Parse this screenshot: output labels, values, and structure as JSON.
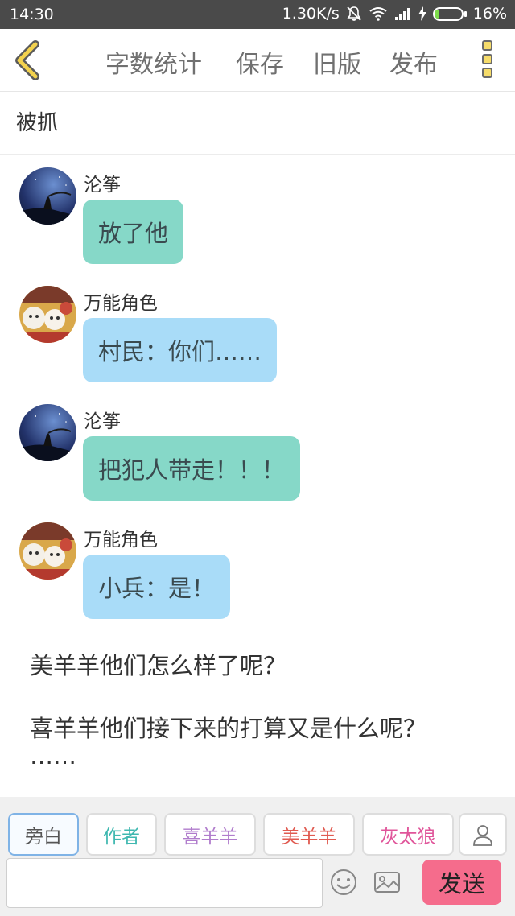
{
  "status_bar": {
    "time": "14:30",
    "network_speed": "1.30K/s",
    "battery_percent": "16%",
    "battery_level": 0.16
  },
  "toolbar": {
    "word_count": "字数统计",
    "save": "保存",
    "old_version": "旧版",
    "publish": "发布"
  },
  "title": "被抓",
  "messages": [
    {
      "sender": "沦筝",
      "text": "放了他"
    },
    {
      "sender": "万能角色",
      "text": "村民：你们……"
    },
    {
      "sender": "沦筝",
      "text": "把犯人带走！！！"
    },
    {
      "sender": "万能角色",
      "text": "小兵：是！"
    }
  ],
  "narration": [
    "美羊羊他们怎么样了呢？",
    "喜羊羊他们接下来的打算又是什么呢？",
    "……"
  ],
  "roles": {
    "narrator": "旁白",
    "author": "作者",
    "xiyangyang": "喜羊羊",
    "meiyangyang": "美羊羊",
    "huitailang": "灰太狼"
  },
  "input": {
    "value": "",
    "placeholder": ""
  },
  "send_label": "发送",
  "colors": {
    "green_bubble": "#86d8c8",
    "blue_bubble": "#a9dcf8",
    "send_button": "#f56c8c",
    "author_role": "#3fb8b0",
    "xiyangyang_role": "#b07ccc",
    "meiyangyang_role": "#e05a50",
    "huitailang_role": "#e0559a"
  }
}
